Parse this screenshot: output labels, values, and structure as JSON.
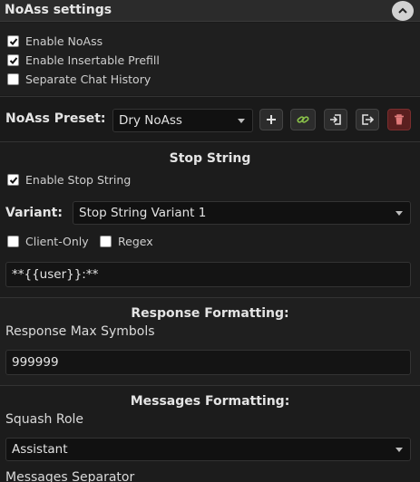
{
  "header": {
    "title": "NoAss settings"
  },
  "general": {
    "enable_noass": "Enable NoAss",
    "enable_insertable_prefill": "Enable Insertable Prefill",
    "separate_chat_history": "Separate Chat History"
  },
  "preset": {
    "label": "NoAss Preset:",
    "selected": "Dry NoAss"
  },
  "stop_string": {
    "title": "Stop String",
    "enable_label": "Enable Stop String",
    "variant_label": "Variant:",
    "variant_selected": "Stop String Variant 1",
    "client_only_label": "Client-Only",
    "regex_label": "Regex",
    "value": "**{{user}}:**"
  },
  "response_formatting": {
    "title": "Response Formatting:",
    "max_symbols_label": "Response Max Symbols",
    "max_symbols_value": "999999"
  },
  "messages_formatting": {
    "title": "Messages Formatting:",
    "squash_role_label": "Squash Role",
    "squash_role_selected": "Assistant",
    "separator_label": "Messages Separator"
  },
  "colors": {
    "link_icon": "#8bc34a",
    "delete_button_bg": "#5a1f1f",
    "delete_icon": "#e07a7a"
  }
}
